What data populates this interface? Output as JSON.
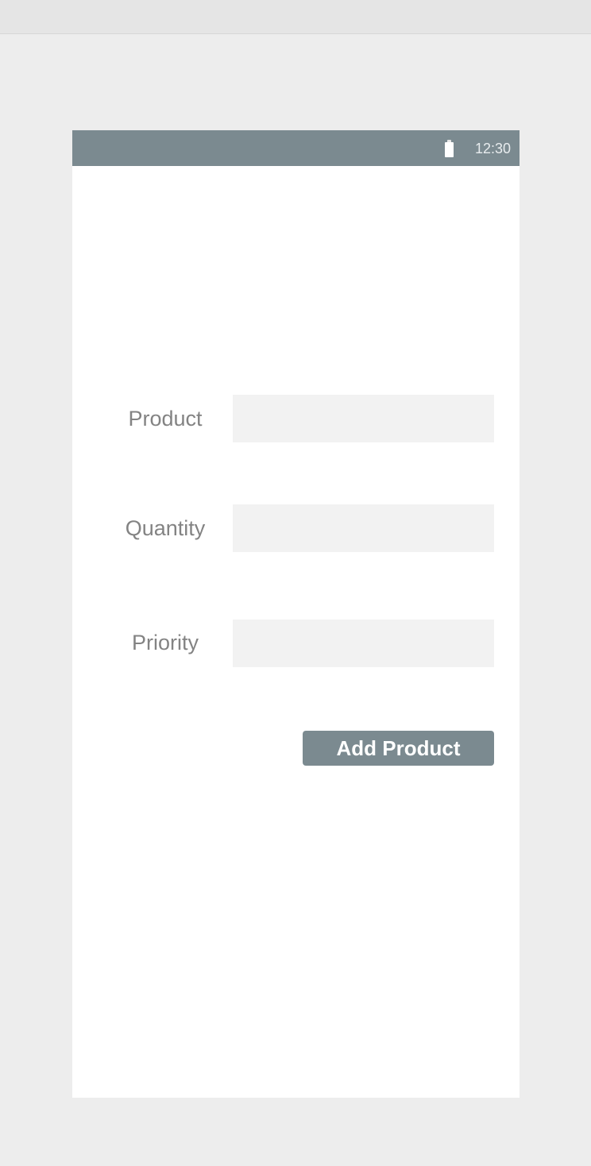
{
  "status_bar": {
    "time": "12:30",
    "battery_icon": "battery-full-icon",
    "color": "#7b8a90"
  },
  "form": {
    "fields": [
      {
        "label": "Product",
        "value": "",
        "placeholder": ""
      },
      {
        "label": "Quantity",
        "value": "",
        "placeholder": ""
      },
      {
        "label": "Priority",
        "value": "",
        "placeholder": ""
      }
    ],
    "submit_label": "Add Product"
  },
  "colors": {
    "accent": "#7b8a90",
    "background": "#ededed",
    "input_background": "#f2f2f2",
    "label_text": "#838383"
  }
}
